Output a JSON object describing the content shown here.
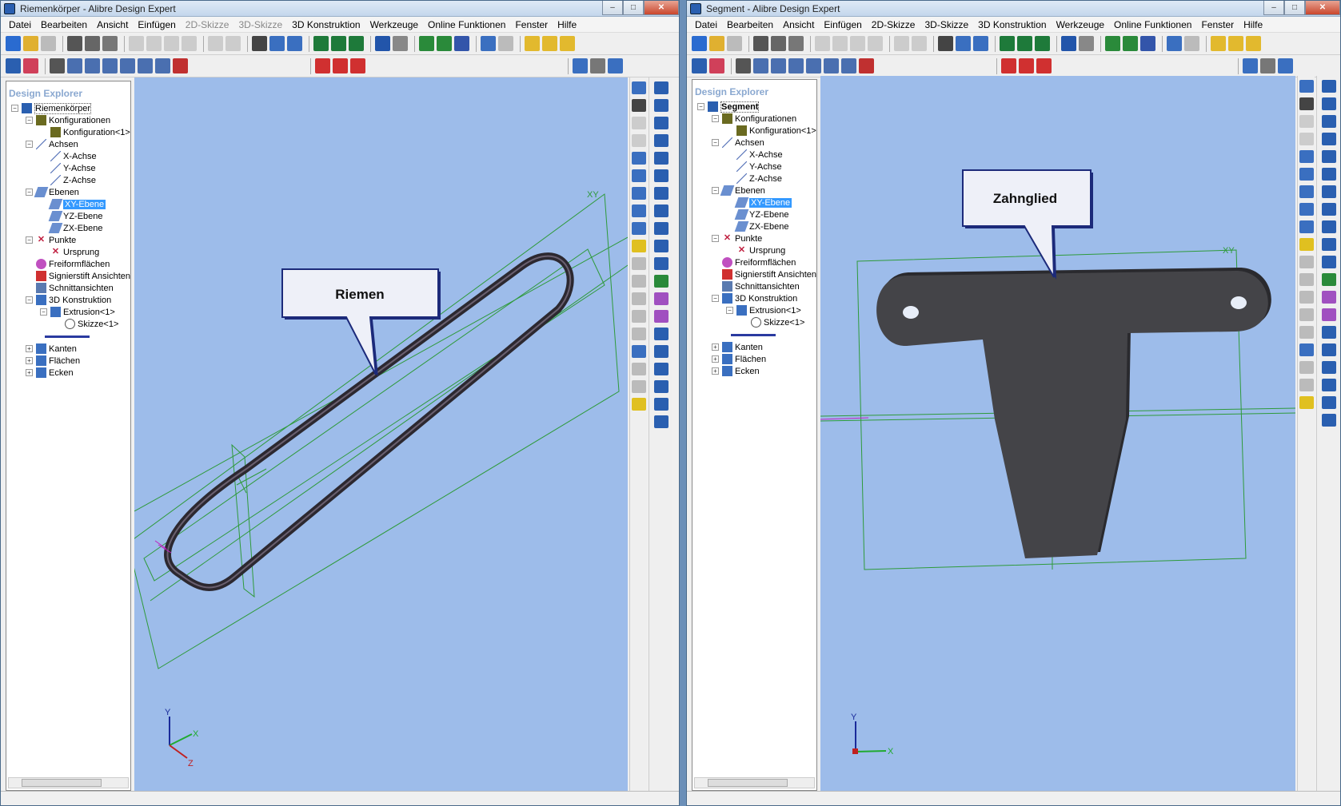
{
  "left": {
    "title": "Riemenkörper - Alibre Design Expert",
    "menu": [
      "Datei",
      "Bearbeiten",
      "Ansicht",
      "Einfügen",
      "2D-Skizze",
      "3D-Skizze",
      "3D Konstruktion",
      "Werkzeuge",
      "Online Funktionen",
      "Fenster",
      "Hilfe"
    ],
    "explorer_title": "Design Explorer",
    "tree": {
      "root": "Riemenkörper",
      "konfigurationen": "Konfigurationen",
      "konfiguration": "Konfiguration<1>",
      "achsen": "Achsen",
      "x_achse": "X-Achse",
      "y_achse": "Y-Achse",
      "z_achse": "Z-Achse",
      "ebenen": "Ebenen",
      "xy_ebene": "XY-Ebene",
      "yz_ebene": "YZ-Ebene",
      "zx_ebene": "ZX-Ebene",
      "punkte": "Punkte",
      "ursprung": "Ursprung",
      "freiform": "Freiformflächen",
      "signier": "Signierstift Ansichten",
      "schnitt": "Schnittansichten",
      "konstruktion": "3D Konstruktion",
      "extrusion": "Extrusion<1>",
      "skizze": "Skizze<1>",
      "kanten": "Kanten",
      "flaechen": "Flächen",
      "ecken": "Ecken"
    },
    "callout": "Riemen",
    "plane_label": "XY",
    "axis_labels": {
      "y": "Y",
      "x": "X",
      "z": "Z"
    }
  },
  "right": {
    "title": "Segment - Alibre Design Expert",
    "menu": [
      "Datei",
      "Bearbeiten",
      "Ansicht",
      "Einfügen",
      "2D-Skizze",
      "3D-Skizze",
      "3D Konstruktion",
      "Werkzeuge",
      "Online Funktionen",
      "Fenster",
      "Hilfe"
    ],
    "explorer_title": "Design Explorer",
    "tree": {
      "root": "Segment",
      "konfigurationen": "Konfigurationen",
      "konfiguration": "Konfiguration<1>",
      "achsen": "Achsen",
      "x_achse": "X-Achse",
      "y_achse": "Y-Achse",
      "z_achse": "Z-Achse",
      "ebenen": "Ebenen",
      "xy_ebene": "XY-Ebene",
      "yz_ebene": "YZ-Ebene",
      "zx_ebene": "ZX-Ebene",
      "punkte": "Punkte",
      "ursprung": "Ursprung",
      "freiform": "Freiformflächen",
      "signier": "Signierstift Ansichten",
      "schnitt": "Schnittansichten",
      "konstruktion": "3D Konstruktion",
      "extrusion": "Extrusion<1>",
      "skizze": "Skizze<1>",
      "kanten": "Kanten",
      "flaechen": "Flächen",
      "ecken": "Ecken"
    },
    "callout": "Zahnglied",
    "plane_label": "XY",
    "axis_labels": {
      "y": "Y",
      "x": "X"
    }
  },
  "colors": {
    "viewport": "#9dbcea",
    "selection": "#3399ff",
    "plane": "#2e9a3a",
    "part": "#444448"
  }
}
